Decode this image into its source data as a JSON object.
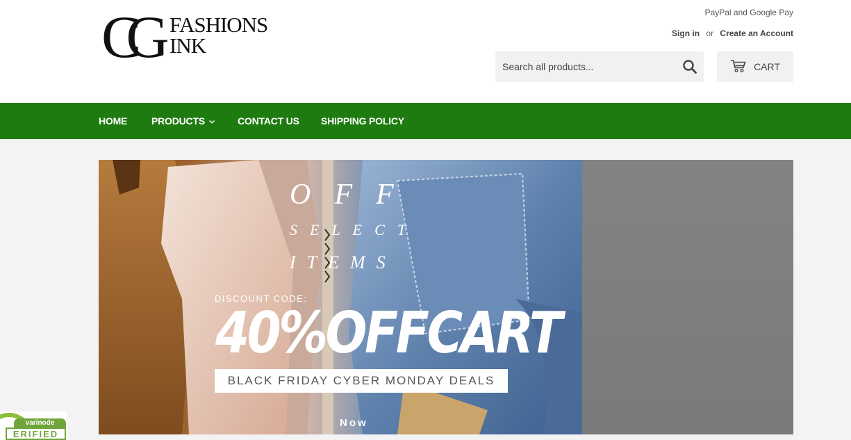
{
  "header": {
    "payment_note": "PayPal and Google Pay",
    "logo": {
      "mark": "CG",
      "line1": "FASHIONS",
      "line2": "INK"
    },
    "account": {
      "sign_in": "Sign in",
      "or": "or",
      "create_account": "Create an Account"
    },
    "search": {
      "placeholder": "Search all products...",
      "icon": "search-icon"
    },
    "cart": {
      "label": "CART",
      "icon": "cart-icon"
    }
  },
  "nav": {
    "background": "#1e7b0f",
    "items": [
      {
        "label": "HOME"
      },
      {
        "label": "PRODUCTS"
      },
      {
        "label": "CONTACT US"
      },
      {
        "label": "SHIPPING POLICY"
      }
    ]
  },
  "banner": {
    "off": "OFF",
    "select": "SELECT",
    "items": "ITEMS",
    "discount_label": "DISCOUNT CODE:",
    "code": "40%OFFCART",
    "deals": "BLACK FRIDAY CYBER MONDAY DEALS",
    "cta": "Now"
  },
  "badge": {
    "top": "varinode",
    "bottom": "ERIFIED"
  }
}
